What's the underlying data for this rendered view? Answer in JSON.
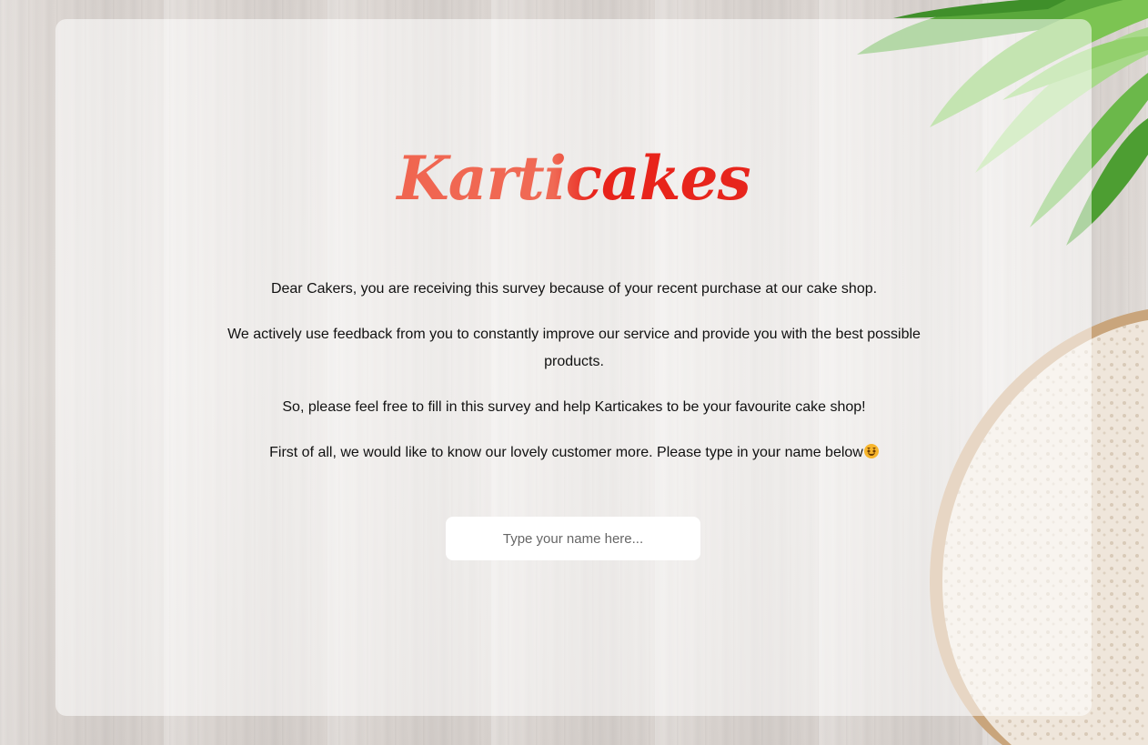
{
  "brand": {
    "logo_text": "Karticakes",
    "accent": "#e8321f"
  },
  "intro": {
    "paragraph_1": "Dear Cakers, you are receiving this survey because of your recent purchase at our cake shop.",
    "paragraph_2": "We actively use feedback from you to constantly improve our service and provide you with the best possible products.",
    "paragraph_3": "So, please feel free to fill in this survey and help Karticakes to be your favourite cake shop!",
    "paragraph_4": "First of all, we would like to know our lovely customer more. Please type in your name below"
  },
  "icons": {
    "smile": "smiling-face-icon",
    "leaves": "leaves-decoration",
    "bread": "bread-decoration"
  },
  "form": {
    "name_input": {
      "value": "",
      "placeholder": "Type your name here..."
    }
  }
}
